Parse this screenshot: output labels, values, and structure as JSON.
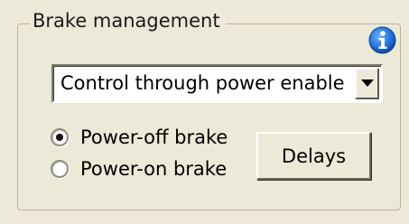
{
  "group": {
    "title": "Brake management"
  },
  "info": {
    "icon": "info-icon",
    "color": "#1f6fd6"
  },
  "select": {
    "value": "Control through power enable",
    "dropdown_icon": "chevron-down-icon"
  },
  "radios": [
    {
      "label": "Power-off brake",
      "checked": true
    },
    {
      "label": "Power-on brake",
      "checked": false
    }
  ],
  "buttons": {
    "delays_label": "Delays"
  }
}
